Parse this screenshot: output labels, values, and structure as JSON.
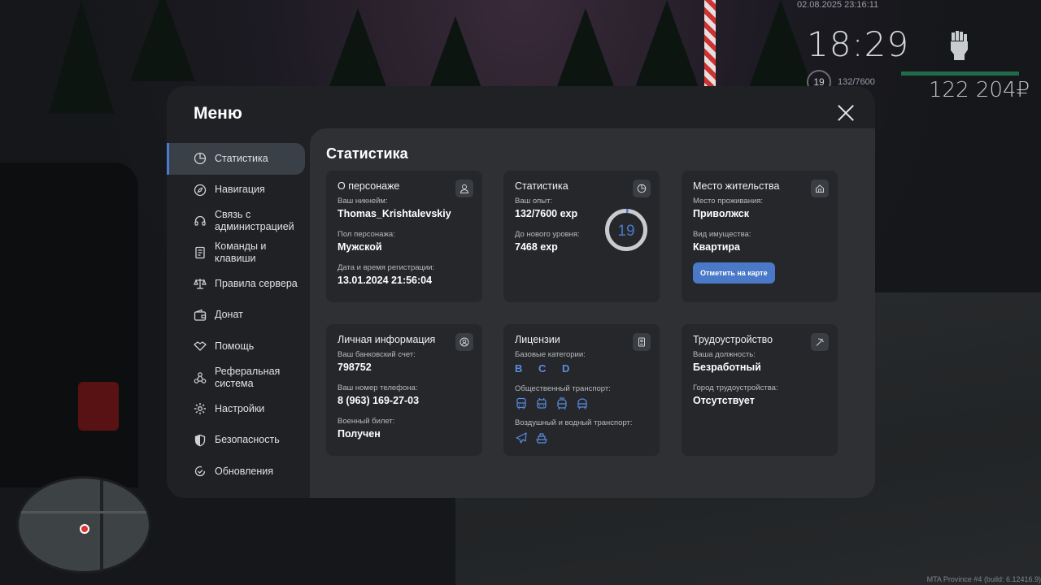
{
  "hud": {
    "datetime": "02.08.2025 23:16:11",
    "clock": "18:29",
    "level": "19",
    "exp": "132/7600",
    "money": "122 204₽",
    "build": "MTA Province #4 (build: 6.12416.9)"
  },
  "menu": {
    "title": "Меню",
    "sidebar": [
      {
        "label": "Статистика",
        "icon": "pie-chart-icon"
      },
      {
        "label": "Навигация",
        "icon": "compass-icon"
      },
      {
        "label": "Связь с администрацией",
        "icon": "headset-icon"
      },
      {
        "label": "Команды и клавиши",
        "icon": "document-icon"
      },
      {
        "label": "Правила сервера",
        "icon": "scales-icon"
      },
      {
        "label": "Донат",
        "icon": "wallet-icon"
      },
      {
        "label": "Помощь",
        "icon": "handshake-icon"
      },
      {
        "label": "Реферальная система",
        "icon": "network-icon"
      },
      {
        "label": "Настройки",
        "icon": "gear-icon"
      },
      {
        "label": "Безопасность",
        "icon": "shield-icon"
      },
      {
        "label": "Обновления",
        "icon": "refresh-icon"
      }
    ],
    "content_title": "Статистика",
    "cards": {
      "character": {
        "title": "О персонаже",
        "nickname_label": "Ваш никнейм:",
        "nickname": "Thomas_Krishtalevskiy",
        "gender_label": "Пол персонажа:",
        "gender": "Мужской",
        "reg_label": "Дата и время регистрации:",
        "reg": "13.01.2024 21:56:04"
      },
      "stats": {
        "title": "Статистика",
        "exp_label": "Ваш опыт:",
        "exp": "132/7600 exp",
        "next_label": "До нового уровня:",
        "next": "7468 exp",
        "level": "19",
        "progress": 0.0174
      },
      "residence": {
        "title": "Место жительства",
        "place_label": "Место проживания:",
        "place": "Приволжск",
        "property_label": "Вид имущества:",
        "property": "Квартира",
        "button": "Отметить на карте"
      },
      "personal": {
        "title": "Личная информация",
        "bank_label": "Ваш банковский счет:",
        "bank": "798752",
        "phone_label": "Ваш номер телефона:",
        "phone": "8 (963) 169-27-03",
        "military_label": "Военный билет:",
        "military": "Получен"
      },
      "licenses": {
        "title": "Лицензии",
        "base_label": "Базовые категории:",
        "base": "B C D",
        "public_label": "Общественный транспорт:",
        "air_label": "Воздушный и водный транспорт:"
      },
      "employment": {
        "title": "Трудоустройство",
        "position_label": "Ваша должность:",
        "position": "Безработный",
        "city_label": "Город трудоустройства:",
        "city": "Отсутствует"
      }
    }
  },
  "colors": {
    "accent": "#4a79c8",
    "panel": "#1f2124",
    "content": "#2e3033",
    "card": "#25272a"
  }
}
